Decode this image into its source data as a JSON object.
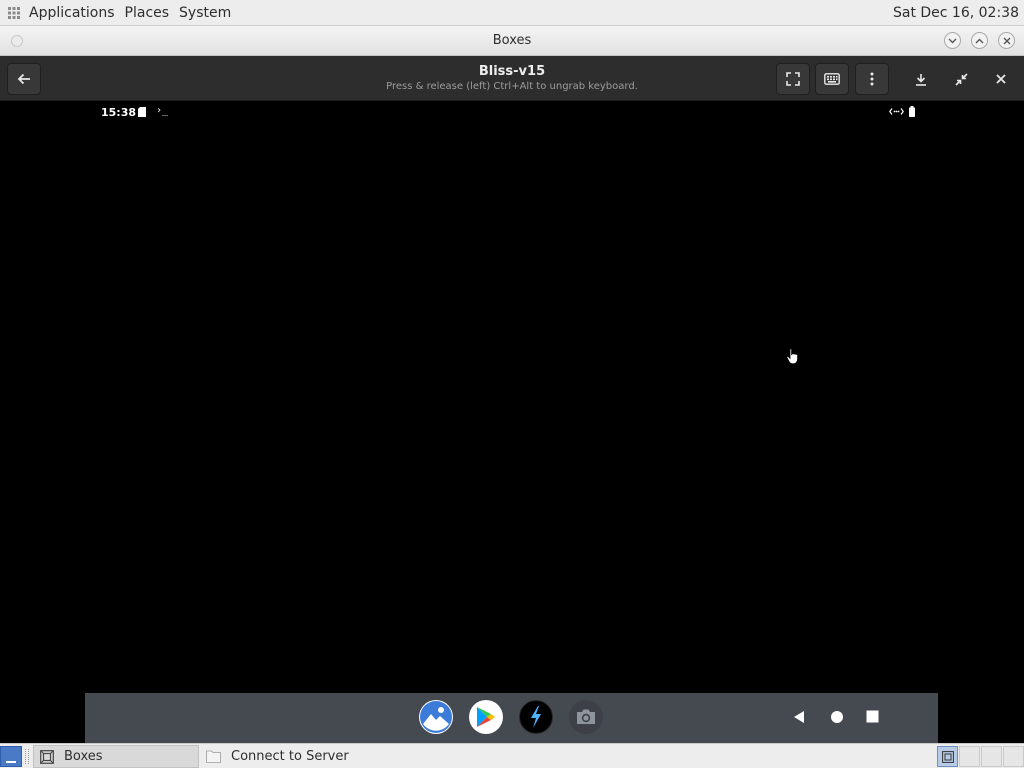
{
  "top_panel": {
    "menus": [
      "Applications",
      "Places",
      "System"
    ],
    "clock": "Sat Dec 16, 02:38"
  },
  "window": {
    "title": "Boxes"
  },
  "boxes_header": {
    "title": "Bliss-v15",
    "subtitle": "Press & release (left) Ctrl+Alt to ungrab keyboard."
  },
  "android": {
    "status_time": "15:38",
    "terminal_glyph": "›_",
    "dock_apps": [
      {
        "name": "gallery",
        "icon": "gallery-icon"
      },
      {
        "name": "play-store",
        "icon": "play-store-icon"
      },
      {
        "name": "bolt",
        "icon": "bolt-icon"
      },
      {
        "name": "camera",
        "icon": "camera-icon"
      }
    ],
    "nav": [
      "back-triangle-icon",
      "home-circle-icon",
      "recents-square-icon"
    ]
  },
  "bottom_panel": {
    "tasks": [
      {
        "label": "Boxes",
        "icon": "boxes-icon",
        "active": true
      },
      {
        "label": "Connect to Server",
        "icon": "folder-icon",
        "active": false
      }
    ]
  },
  "colors": {
    "header_bg": "#2d2d2d",
    "panel_bg": "#ededed",
    "android_taskbar": "#454a51",
    "show_desktop": "#4a79c6"
  }
}
